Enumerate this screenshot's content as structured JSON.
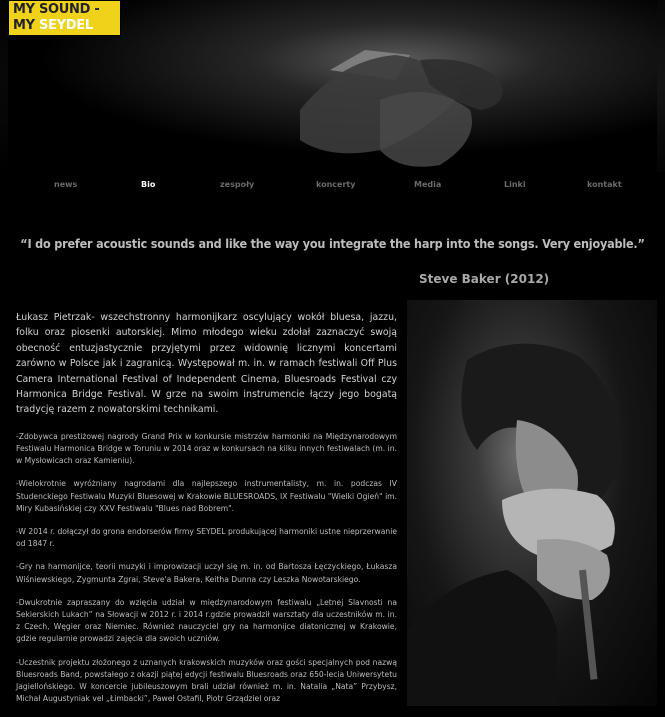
{
  "logo": {
    "line1": "MY SOUND -",
    "line2_a": "MY ",
    "line2_b": "SEYDEL"
  },
  "nav": [
    {
      "label": "news"
    },
    {
      "label": "Bio"
    },
    {
      "label": "zespoły"
    },
    {
      "label": "koncerty"
    },
    {
      "label": "Media"
    },
    {
      "label": "Linki"
    },
    {
      "label": "kontakt"
    }
  ],
  "quote": {
    "text": "“I do prefer acoustic sounds and like the way you integrate the harp into the songs. Very enjoyable.”",
    "author": "Steve Baker (2012)"
  },
  "bio": {
    "intro": "Łukasz Pietrzak- wszechstronny harmonijkarz oscylujący wokół bluesa, jazzu, folku oraz piosenki autorskiej. Mimo młodego wieku zdołał zaznaczyć swoją obecność entuzjastycznie przyjętymi przez widownię licznymi koncertami zarówno w Polsce jak i zagranicą. Występował m. in. w ramach festiwali Off Plus Camera International Festival of Independent Cinema, Bluesroads Festival czy Harmonica Bridge Festival. W grze na swoim instrumencie łączy jego bogatą tradycję razem z nowatorskimi technikami.",
    "items": [
      "-Zdobywca prestiżowej nagrody Grand Prix w konkursie mistrzów harmoniki na Międzynarodowym Festiwalu Harmonica Bridge w Toruniu w 2014 oraz w konkursach na kilku innych festiwalach (m. in. w Mysłowicach oraz Kamieniu).",
      "-Wielokrotnie wyróżniany nagrodami dla najlepszego instrumentalisty, m. in. podczas IV Studenckiego Festiwalu Muzyki Bluesowej w Krakowie BLUESROADS, IX Festiwalu \"Wielki Ogień\" im. Miry Kubasińskiej czy XXV Festiwalu \"Blues nad Bobrem\".",
      "-W 2014 r. dołączył do grona endorserów firmy SEYDEL produkującej harmoniki ustne nieprzerwanie od 1847 r.",
      "-Gry na harmonijce, teorii muzyki i improwizacji uczył się m. in. od Bartosza Łęczyckiego, Łukasza Wiśniewskiego, Zygmunta Zgrai, Steve'a Bakera, Keitha Dunna czy Leszka Nowotarskiego.",
      "-Dwukrotnie zapraszany do wzięcia udział w międzynarodowym festiwalu „Letnej Slavnosti na Sekierskich Lukach” na Słowacji w 2012 r. i 2014 r.gdzie prowadził warsztaty dla uczestników m. in. z Czech, Węgier oraz Niemiec. Również nauczyciel gry na harmonijce diatonicznej w Krakowie, gdzie regularnie prowadzi zajęcia dla swoich uczniów.",
      "-Uczestnik projektu złożonego z uznanych krakowskich muzyków oraz gości specjalnych pod nazwą Bluesroads Band, powstałego z okazji piątej edycji festiwalu Bluesroads oraz 650-lecia Uniwersytetu Jagiellońskiego. W koncercie jubileuszowym brali udział również m. in. Natalia „Nata” Przybysz, Michał Augustyniak vel „Łimbacki”, Paweł Ostafil, Piotr Grządziel oraz"
    ]
  },
  "colors": {
    "logo_bg": "#f0d21a",
    "nav_active": "#ffffff",
    "nav_inactive": "#6a6a6a",
    "page_bg": "#000000"
  }
}
